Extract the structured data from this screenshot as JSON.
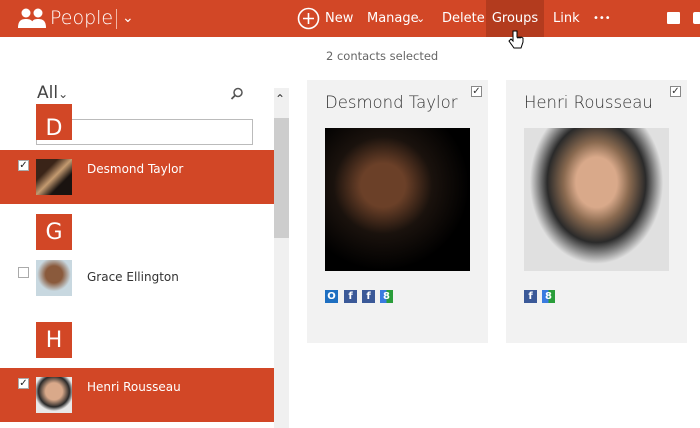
{
  "header": {
    "app_title": "People",
    "new_label": "New",
    "manage_label": "Manage",
    "delete_label": "Delete",
    "groups_label": "Groups",
    "link_label": "Link",
    "more_label": "•••",
    "accent": "#d24726"
  },
  "filter": {
    "label": "All"
  },
  "search": {
    "placeholder": "",
    "value": ""
  },
  "status": "2 contacts selected",
  "list": [
    {
      "type": "letter",
      "text": "D"
    },
    {
      "type": "contact",
      "name": "Desmond Taylor",
      "selected": true,
      "check": "✓"
    },
    {
      "type": "letter",
      "text": "G"
    },
    {
      "type": "contact",
      "name": "Grace Ellington",
      "selected": false,
      "check": ""
    },
    {
      "type": "letter",
      "text": "H"
    },
    {
      "type": "contact",
      "name": "Henri Rousseau",
      "selected": true,
      "check": "✓"
    }
  ],
  "cards": [
    {
      "name": "Desmond Taylor",
      "check": "✓",
      "services": [
        "outlook-icon",
        "facebook-icon",
        "facebook-icon",
        "google-icon"
      ]
    },
    {
      "name": "Henri Rousseau",
      "check": "✓",
      "services": [
        "facebook-icon",
        "google-icon"
      ]
    }
  ]
}
